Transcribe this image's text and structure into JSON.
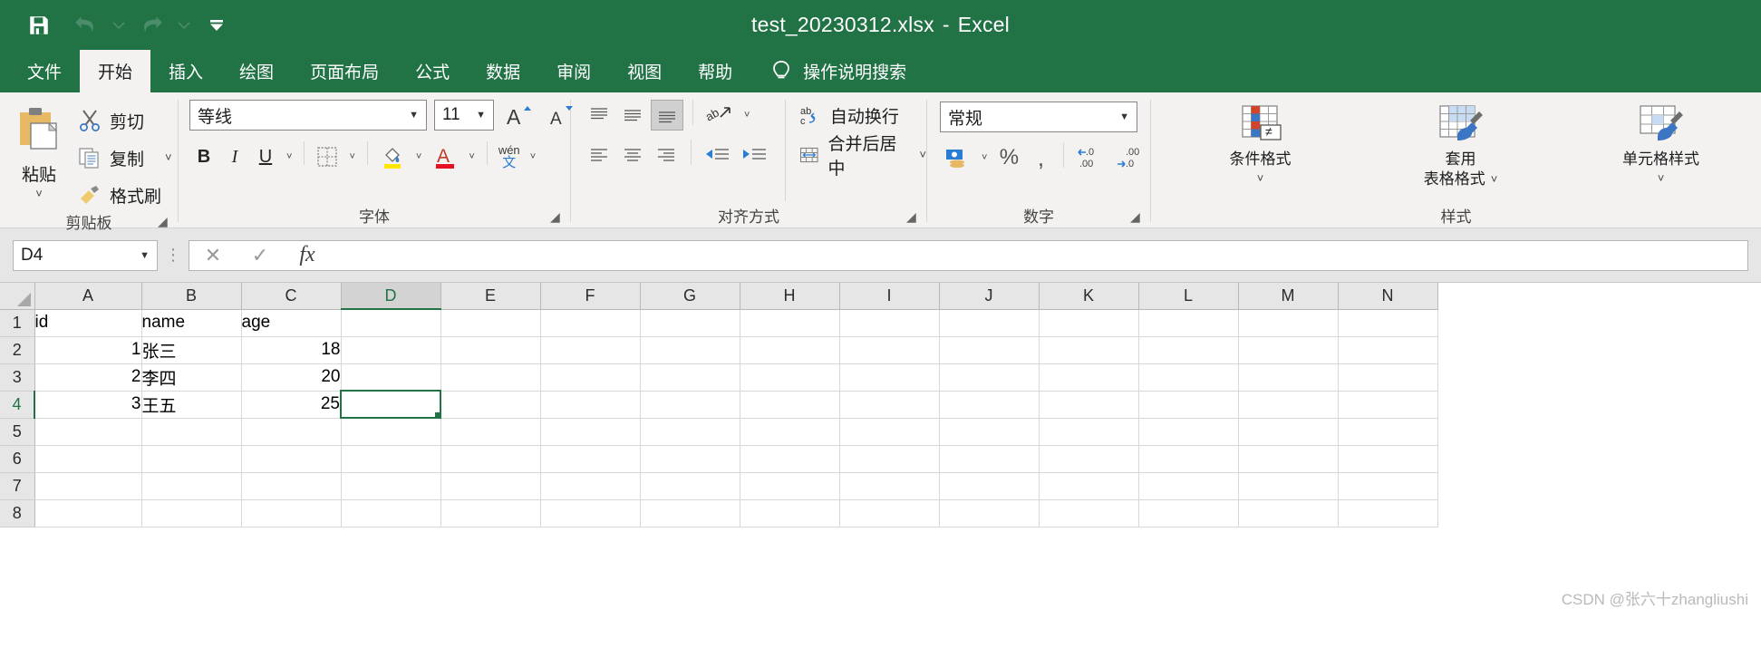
{
  "titlebar": {
    "document_name": "test_20230312.xlsx",
    "separator": "-",
    "app_name": "Excel",
    "quick_access": [
      {
        "name": "save",
        "icon": "save-icon"
      },
      {
        "name": "undo",
        "icon": "undo-icon"
      },
      {
        "name": "undo-dropdown",
        "icon": "chevron-down-icon"
      },
      {
        "name": "redo",
        "icon": "redo-icon"
      },
      {
        "name": "redo-dropdown",
        "icon": "chevron-down-icon"
      },
      {
        "name": "customize-quick-access-toolbar",
        "icon": "customize-qat-icon"
      }
    ]
  },
  "tabs": [
    {
      "label": "文件",
      "active": false
    },
    {
      "label": "开始",
      "active": true
    },
    {
      "label": "插入",
      "active": false
    },
    {
      "label": "绘图",
      "active": false
    },
    {
      "label": "页面布局",
      "active": false
    },
    {
      "label": "公式",
      "active": false
    },
    {
      "label": "数据",
      "active": false
    },
    {
      "label": "审阅",
      "active": false
    },
    {
      "label": "视图",
      "active": false
    },
    {
      "label": "帮助",
      "active": false
    }
  ],
  "tell_me": {
    "label": "操作说明搜索",
    "icon": "lightbulb-icon"
  },
  "ribbon": {
    "clipboard": {
      "group_label": "剪贴板",
      "paste_label": "粘贴",
      "cut_label": "剪切",
      "copy_label": "复制",
      "format_painter_label": "格式刷"
    },
    "font": {
      "group_label": "字体",
      "font_name": "等线",
      "font_size": "11",
      "bold": "B",
      "italic": "I",
      "underline": "U",
      "grow_font": "A",
      "shrink_font": "A",
      "phonetic_top": "wén",
      "phonetic_bottom": "文"
    },
    "alignment": {
      "group_label": "对齐方式",
      "wrap_text_label": "自动换行",
      "merge_center_label": "合并后居中",
      "orientation_icon_text": "ab"
    },
    "number": {
      "group_label": "数字",
      "format": "常规",
      "percent": "%",
      "comma": ",",
      "increase_decimal": ".00",
      "decrease_decimal": ".00"
    },
    "styles": {
      "group_label": "样式",
      "conditional_formatting": "条件格式",
      "format_as_table_line1": "套用",
      "format_as_table_line2": "表格格式",
      "cell_styles": "单元格样式"
    }
  },
  "formula_bar": {
    "name_box_value": "D4",
    "cancel_icon": "close-icon",
    "enter_icon": "check-icon",
    "function_icon": "fx",
    "formula_value": ""
  },
  "grid": {
    "columns": [
      "A",
      "B",
      "C",
      "D",
      "E",
      "F",
      "G",
      "H",
      "I",
      "J",
      "K",
      "L",
      "M",
      "N"
    ],
    "selected_column": "D",
    "selected_row": "4",
    "selected_cell": "D4",
    "rows": [
      {
        "header": "1",
        "cells": [
          {
            "v": "id",
            "align": "left"
          },
          {
            "v": "name",
            "align": "left"
          },
          {
            "v": "age",
            "align": "left"
          },
          {
            "v": "",
            "align": "left"
          },
          {
            "v": "",
            "align": "left"
          },
          {
            "v": "",
            "align": "left"
          },
          {
            "v": "",
            "align": "left"
          },
          {
            "v": "",
            "align": "left"
          },
          {
            "v": "",
            "align": "left"
          },
          {
            "v": "",
            "align": "left"
          },
          {
            "v": "",
            "align": "left"
          },
          {
            "v": "",
            "align": "left"
          },
          {
            "v": "",
            "align": "left"
          },
          {
            "v": "",
            "align": "left"
          }
        ]
      },
      {
        "header": "2",
        "cells": [
          {
            "v": "1",
            "align": "right"
          },
          {
            "v": "张三",
            "align": "left"
          },
          {
            "v": "18",
            "align": "right"
          },
          {
            "v": "",
            "align": "left"
          },
          {
            "v": "",
            "align": "left"
          },
          {
            "v": "",
            "align": "left"
          },
          {
            "v": "",
            "align": "left"
          },
          {
            "v": "",
            "align": "left"
          },
          {
            "v": "",
            "align": "left"
          },
          {
            "v": "",
            "align": "left"
          },
          {
            "v": "",
            "align": "left"
          },
          {
            "v": "",
            "align": "left"
          },
          {
            "v": "",
            "align": "left"
          },
          {
            "v": "",
            "align": "left"
          }
        ]
      },
      {
        "header": "3",
        "cells": [
          {
            "v": "2",
            "align": "right"
          },
          {
            "v": "李四",
            "align": "left"
          },
          {
            "v": "20",
            "align": "right"
          },
          {
            "v": "",
            "align": "left"
          },
          {
            "v": "",
            "align": "left"
          },
          {
            "v": "",
            "align": "left"
          },
          {
            "v": "",
            "align": "left"
          },
          {
            "v": "",
            "align": "left"
          },
          {
            "v": "",
            "align": "left"
          },
          {
            "v": "",
            "align": "left"
          },
          {
            "v": "",
            "align": "left"
          },
          {
            "v": "",
            "align": "left"
          },
          {
            "v": "",
            "align": "left"
          },
          {
            "v": "",
            "align": "left"
          }
        ]
      },
      {
        "header": "4",
        "cells": [
          {
            "v": "3",
            "align": "right"
          },
          {
            "v": "王五",
            "align": "left"
          },
          {
            "v": "25",
            "align": "right"
          },
          {
            "v": "",
            "align": "left"
          },
          {
            "v": "",
            "align": "left"
          },
          {
            "v": "",
            "align": "left"
          },
          {
            "v": "",
            "align": "left"
          },
          {
            "v": "",
            "align": "left"
          },
          {
            "v": "",
            "align": "left"
          },
          {
            "v": "",
            "align": "left"
          },
          {
            "v": "",
            "align": "left"
          },
          {
            "v": "",
            "align": "left"
          },
          {
            "v": "",
            "align": "left"
          },
          {
            "v": "",
            "align": "left"
          }
        ]
      },
      {
        "header": "5",
        "cells": [
          {
            "v": "",
            "align": "left"
          },
          {
            "v": "",
            "align": "left"
          },
          {
            "v": "",
            "align": "left"
          },
          {
            "v": "",
            "align": "left"
          },
          {
            "v": "",
            "align": "left"
          },
          {
            "v": "",
            "align": "left"
          },
          {
            "v": "",
            "align": "left"
          },
          {
            "v": "",
            "align": "left"
          },
          {
            "v": "",
            "align": "left"
          },
          {
            "v": "",
            "align": "left"
          },
          {
            "v": "",
            "align": "left"
          },
          {
            "v": "",
            "align": "left"
          },
          {
            "v": "",
            "align": "left"
          },
          {
            "v": "",
            "align": "left"
          }
        ]
      },
      {
        "header": "6",
        "cells": [
          {
            "v": "",
            "align": "left"
          },
          {
            "v": "",
            "align": "left"
          },
          {
            "v": "",
            "align": "left"
          },
          {
            "v": "",
            "align": "left"
          },
          {
            "v": "",
            "align": "left"
          },
          {
            "v": "",
            "align": "left"
          },
          {
            "v": "",
            "align": "left"
          },
          {
            "v": "",
            "align": "left"
          },
          {
            "v": "",
            "align": "left"
          },
          {
            "v": "",
            "align": "left"
          },
          {
            "v": "",
            "align": "left"
          },
          {
            "v": "",
            "align": "left"
          },
          {
            "v": "",
            "align": "left"
          },
          {
            "v": "",
            "align": "left"
          }
        ]
      },
      {
        "header": "7",
        "cells": [
          {
            "v": "",
            "align": "left"
          },
          {
            "v": "",
            "align": "left"
          },
          {
            "v": "",
            "align": "left"
          },
          {
            "v": "",
            "align": "left"
          },
          {
            "v": "",
            "align": "left"
          },
          {
            "v": "",
            "align": "left"
          },
          {
            "v": "",
            "align": "left"
          },
          {
            "v": "",
            "align": "left"
          },
          {
            "v": "",
            "align": "left"
          },
          {
            "v": "",
            "align": "left"
          },
          {
            "v": "",
            "align": "left"
          },
          {
            "v": "",
            "align": "left"
          },
          {
            "v": "",
            "align": "left"
          },
          {
            "v": "",
            "align": "left"
          }
        ]
      },
      {
        "header": "8",
        "cells": [
          {
            "v": "",
            "align": "left"
          },
          {
            "v": "",
            "align": "left"
          },
          {
            "v": "",
            "align": "left"
          },
          {
            "v": "",
            "align": "left"
          },
          {
            "v": "",
            "align": "left"
          },
          {
            "v": "",
            "align": "left"
          },
          {
            "v": "",
            "align": "left"
          },
          {
            "v": "",
            "align": "left"
          },
          {
            "v": "",
            "align": "left"
          },
          {
            "v": "",
            "align": "left"
          },
          {
            "v": "",
            "align": "left"
          },
          {
            "v": "",
            "align": "left"
          },
          {
            "v": "",
            "align": "left"
          },
          {
            "v": "",
            "align": "left"
          }
        ]
      }
    ]
  },
  "watermark": "CSDN @张六十zhangliushi",
  "colors": {
    "brand_green": "#217346",
    "ribbon_bg": "#f3f2f1",
    "header_bg": "#e6e6e6"
  }
}
